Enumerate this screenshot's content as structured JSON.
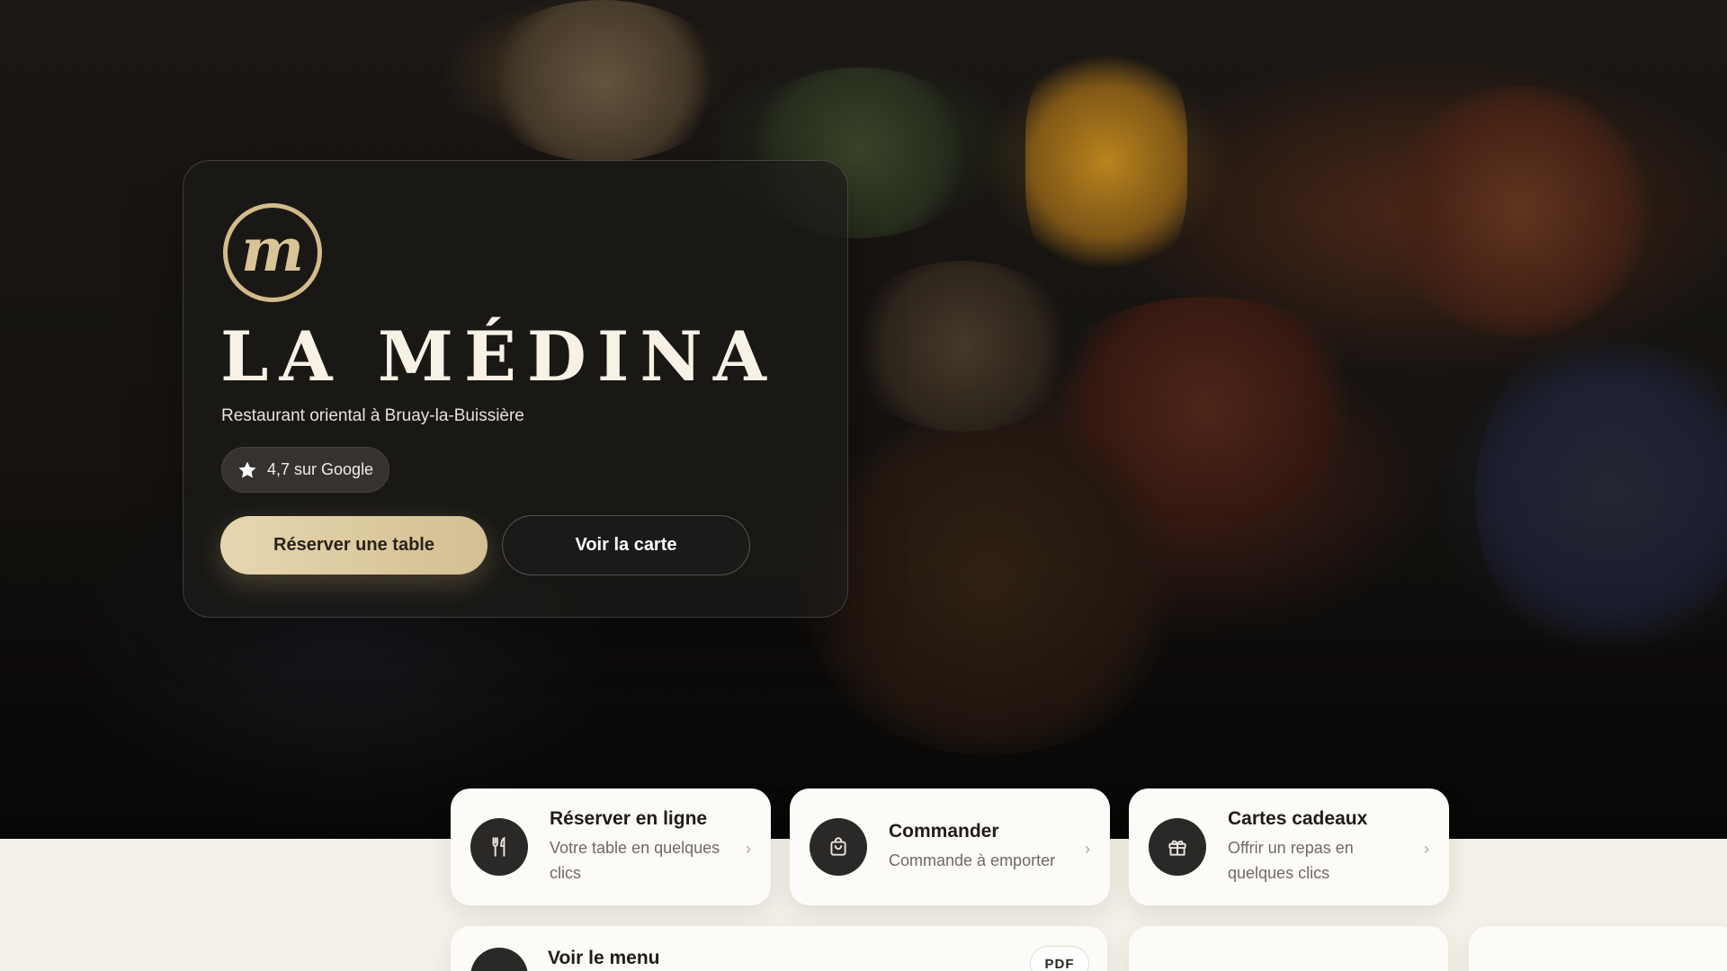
{
  "hero": {
    "brand_name": "LA MÉDINA",
    "logo_letter": "m",
    "subtitle": "Restaurant oriental à Bruay-la-Buissière",
    "rating_text": "4,7 sur Google",
    "primary_button": "Réserver une table",
    "secondary_button": "Voir la carte"
  },
  "quick_actions": [
    {
      "title": "Réserver en ligne",
      "description": "Votre table en quelques clics",
      "icon": "fork-knife-icon"
    },
    {
      "title": "Commander",
      "description": "Commande à emporter",
      "icon": "shopping-bag-icon"
    },
    {
      "title": "Cartes cadeaux",
      "description": "Offrir un repas en quelques clics",
      "icon": "gift-icon"
    }
  ],
  "menu_card": {
    "title": "Voir le menu",
    "badge": "PDF",
    "icon": "menu-icon"
  },
  "colors": {
    "accent_gold": "#d3bf92",
    "card_dark": "#2b2927",
    "page_bg": "#f6f1e8"
  }
}
